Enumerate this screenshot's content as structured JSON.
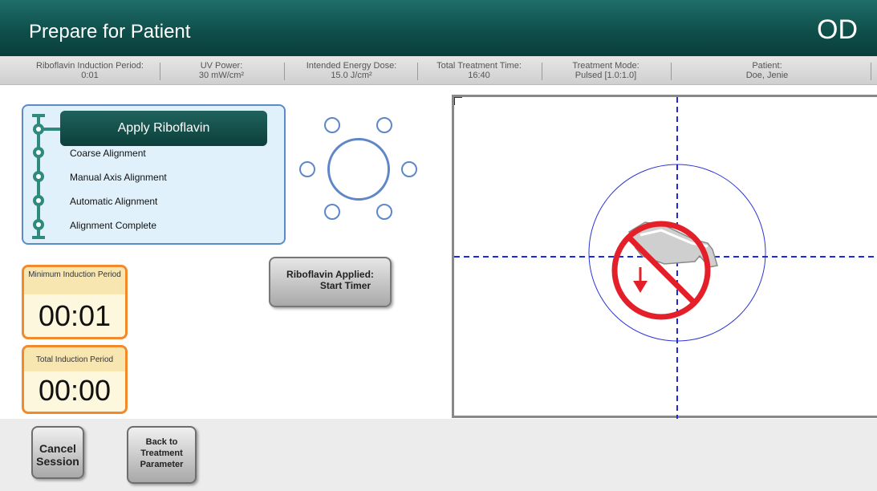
{
  "header": {
    "title": "Prepare for Patient",
    "eye": "OD"
  },
  "infobar": [
    {
      "label": "Riboflavin Induction Period:",
      "value": "0:01"
    },
    {
      "label": "UV Power:",
      "value": "30 mW/cm²"
    },
    {
      "label": "Intended Energy Dose:",
      "value": "15.0 J/cm²"
    },
    {
      "label": "Total Treatment Time:",
      "value": "16:40"
    },
    {
      "label": "Treatment Mode:",
      "value": "Pulsed [1.0:1.0]"
    },
    {
      "label": "Patient:",
      "value": "Doe, Jenie"
    }
  ],
  "steps": {
    "active": "Apply Riboflavin",
    "items": [
      "Coarse Alignment",
      "Manual Axis Alignment",
      "Automatic Alignment",
      "Alignment Complete"
    ]
  },
  "timers": {
    "minimum": {
      "label": "Minimum Induction Period",
      "value": "00:01"
    },
    "total": {
      "label": "Total Induction Period",
      "value": "00:00"
    }
  },
  "buttons": {
    "start_timer_line1": "Riboflavin Applied:",
    "start_timer_line2": "Start Timer",
    "cancel_line1": "Cancel",
    "cancel_line2": "Session",
    "back_line1": "Back to",
    "back_line2": "Treatment",
    "back_line3": "Parameter"
  },
  "colors": {
    "header": "#0f4f4b",
    "accent": "#2e8a7c",
    "timer_border": "#f28a2c",
    "crosshair": "#1a2be0",
    "prohibit": "#e3202a"
  }
}
